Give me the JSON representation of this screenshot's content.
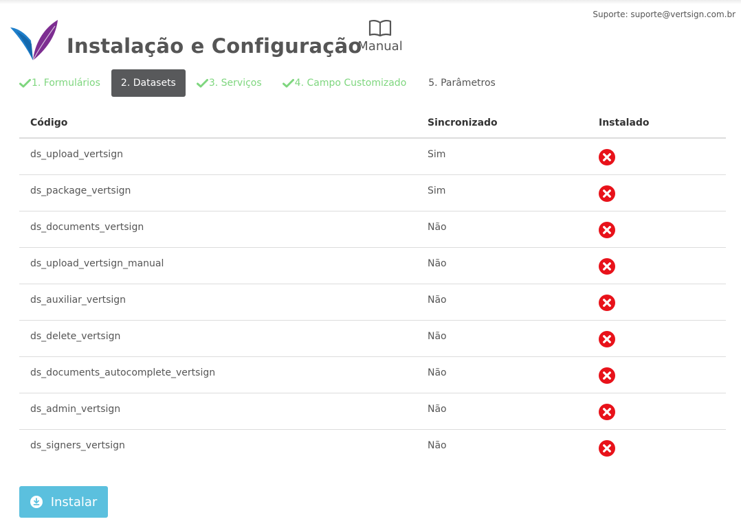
{
  "support_text": "Suporte: suporte@vertsign.com.br",
  "page_title": "Instalação e Configuração",
  "manual_label": "Manual",
  "steps": [
    {
      "label": "1. Formulários",
      "state": "done"
    },
    {
      "label": "2. Datasets",
      "state": "active"
    },
    {
      "label": "3. Serviços",
      "state": "done"
    },
    {
      "label": "4. Campo Customizado",
      "state": "done"
    },
    {
      "label": "5. Parâmetros",
      "state": "pending"
    }
  ],
  "table": {
    "headers": [
      "Código",
      "Sincronizado",
      "Instalado"
    ],
    "rows": [
      {
        "code": "ds_upload_vertsign",
        "sync": "Sim",
        "installed": "error-icon"
      },
      {
        "code": "ds_package_vertsign",
        "sync": "Sim",
        "installed": "error-icon"
      },
      {
        "code": "ds_documents_vertsign",
        "sync": "Não",
        "installed": "error-icon"
      },
      {
        "code": "ds_upload_vertsign_manual",
        "sync": "Não",
        "installed": "error-icon"
      },
      {
        "code": "ds_auxiliar_vertsign",
        "sync": "Não",
        "installed": "error-icon"
      },
      {
        "code": "ds_delete_vertsign",
        "sync": "Não",
        "installed": "error-icon"
      },
      {
        "code": "ds_documents_autocomplete_vertsign",
        "sync": "Não",
        "installed": "error-icon"
      },
      {
        "code": "ds_admin_vertsign",
        "sync": "Não",
        "installed": "error-icon"
      },
      {
        "code": "ds_signers_vertsign",
        "sync": "Não",
        "installed": "error-icon"
      }
    ]
  },
  "install_button": "Instalar",
  "colors": {
    "done": "#7ed67e",
    "active_bg": "#58595b",
    "error": "#e8121a",
    "button": "#5bc0de"
  }
}
